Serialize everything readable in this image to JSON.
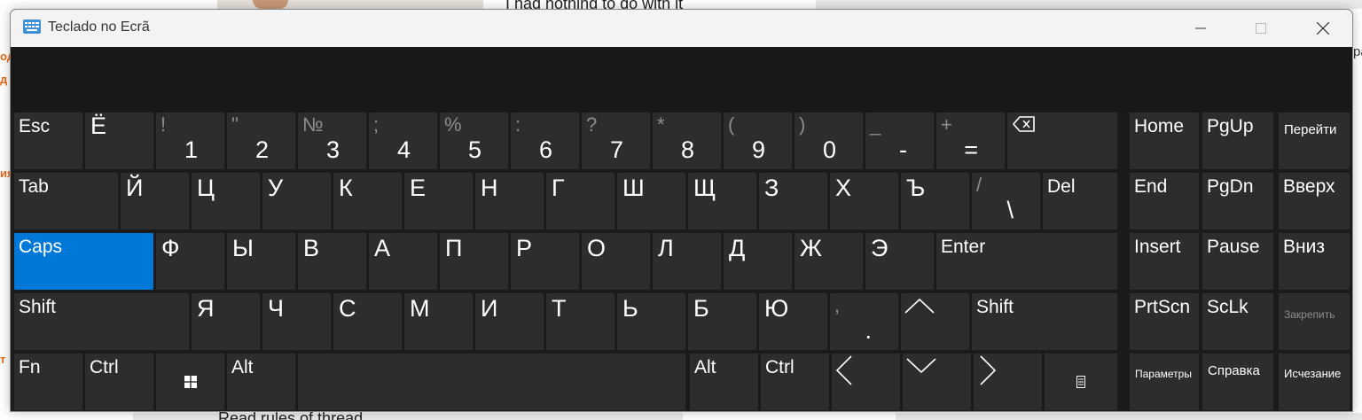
{
  "background": {
    "top_text": "I had nothing to do with it",
    "bottom_text": "Read rules of thread",
    "left_fragments": [
      "од",
      "д",
      "ия",
      "т"
    ],
    "right_fragment": "ра"
  },
  "window": {
    "title": "Teclado no Ecrã",
    "icon": "keyboard-icon",
    "controls": [
      "minimize-icon",
      "maximize-icon",
      "close-icon"
    ]
  },
  "keyboard": {
    "number_row": {
      "esc": "Esc",
      "yo": "Ё",
      "digits": [
        {
          "shift": "!",
          "main": "1"
        },
        {
          "shift": "\"",
          "main": "2"
        },
        {
          "shift": "№",
          "main": "3"
        },
        {
          "shift": ";",
          "main": "4"
        },
        {
          "shift": "%",
          "main": "5"
        },
        {
          "shift": ":",
          "main": "6"
        },
        {
          "shift": "?",
          "main": "7"
        },
        {
          "shift": "*",
          "main": "8"
        },
        {
          "shift": "(",
          "main": "9"
        },
        {
          "shift": ")",
          "main": "0"
        },
        {
          "shift": "_",
          "main": "-"
        },
        {
          "shift": "+",
          "main": "="
        }
      ],
      "backspace_icon": "backspace-icon"
    },
    "row_tab": {
      "tab": "Tab",
      "letters": [
        "Й",
        "Ц",
        "У",
        "К",
        "Е",
        "Н",
        "Г",
        "Ш",
        "Щ",
        "З",
        "Х",
        "Ъ"
      ],
      "slash_shift": "/",
      "slash_main": "\\",
      "del": "Del"
    },
    "row_caps": {
      "caps": "Caps",
      "letters": [
        "Ф",
        "Ы",
        "В",
        "А",
        "П",
        "Р",
        "О",
        "Л",
        "Д",
        "Ж",
        "Э"
      ],
      "enter": "Enter"
    },
    "row_shift": {
      "shift_left": "Shift",
      "letters": [
        "Я",
        "Ч",
        "С",
        "М",
        "И",
        "Т",
        "Ь",
        "Б",
        "Ю"
      ],
      "comma_shift": ",",
      "comma_main": ".",
      "up_icon": "arrow-up-icon",
      "shift_right": "Shift"
    },
    "row_bottom": {
      "fn": "Fn",
      "ctrl_left": "Ctrl",
      "win_icon": "windows-icon",
      "alt_left": "Alt",
      "alt_right": "Alt",
      "ctrl_right": "Ctrl",
      "left_icon": "arrow-left-icon",
      "down_icon": "arrow-down-icon",
      "right_icon": "arrow-right-icon",
      "menu_icon": "context-menu-icon"
    },
    "nav": {
      "home": "Home",
      "pgup": "PgUp",
      "goto": "Перейти",
      "end": "End",
      "pgdn": "PgDn",
      "up": "Вверх",
      "insert": "Insert",
      "pause": "Pause",
      "down": "Вниз",
      "prtscn": "PrtScn",
      "sclk": "ScLk",
      "dock": "Закрепить",
      "options": "Параметры",
      "help": "Справка",
      "fade": "Исчезание"
    },
    "colors": {
      "key": "#2d2d2d",
      "active": "#0078d7",
      "background": "#1b1b1b",
      "secondary_text": "#8c8c8c"
    }
  }
}
